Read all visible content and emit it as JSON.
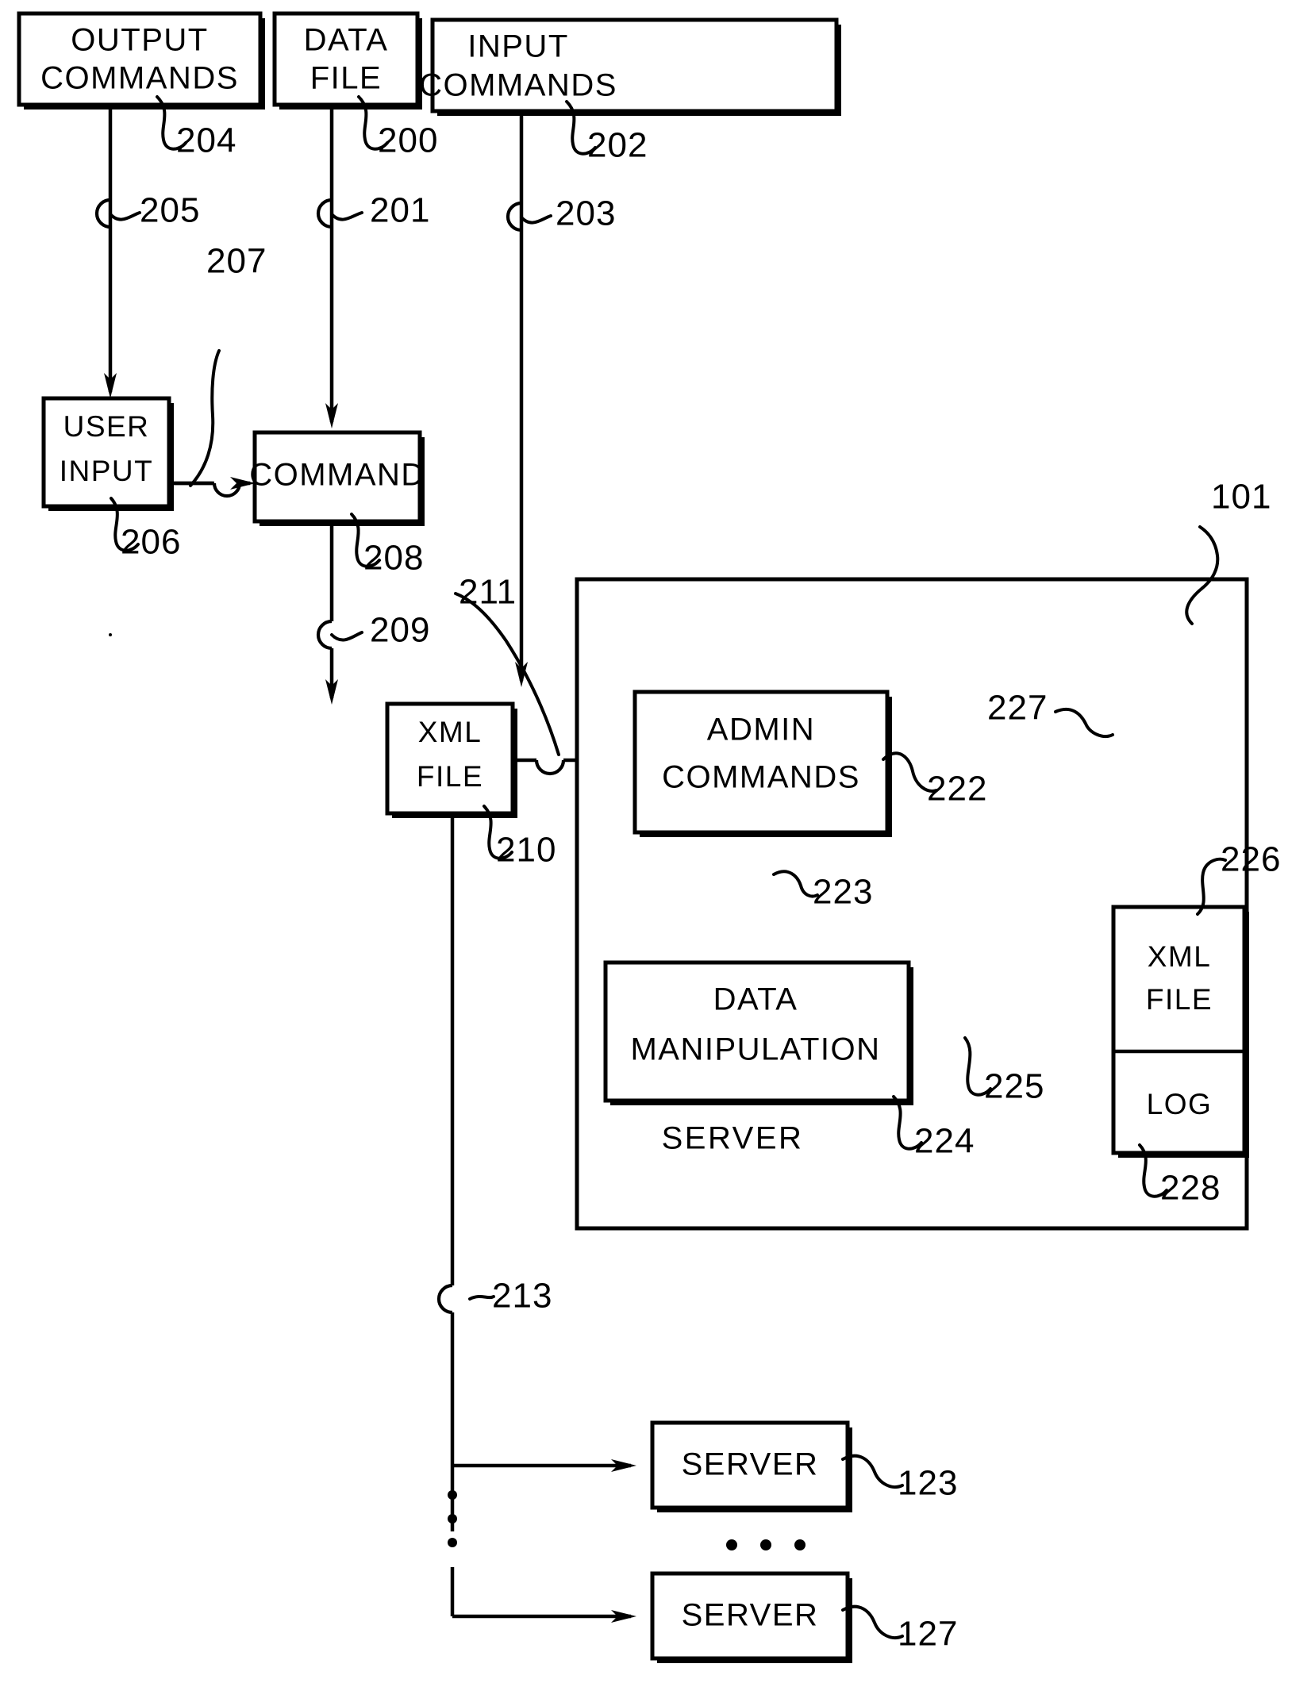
{
  "figure": {
    "type": "patent-block-diagram",
    "background": "#ffffff",
    "ink_color": "#000000"
  },
  "boxes": {
    "output_commands": {
      "line1": "OUTPUT",
      "line2": "COMMANDS",
      "ref": "204"
    },
    "data_file": {
      "line1": "DATA",
      "line2": "FILE",
      "ref": "200"
    },
    "input_commands": {
      "line1": "INPUT",
      "line2": "COMMANDS",
      "ref": "202"
    },
    "user_input": {
      "line1": "USER",
      "line2": "INPUT",
      "ref": "206"
    },
    "command": {
      "line1": "COMMAND",
      "ref": "208"
    },
    "xml_file_client": {
      "line1": "XML",
      "line2": "FILE",
      "ref": "210"
    },
    "admin_commands": {
      "line1": "ADMIN",
      "line2": "COMMANDS",
      "ref": "222"
    },
    "data_manipulation": {
      "line1": "DATA",
      "line2": "MANIPULATION",
      "ref": "224"
    },
    "xml_file_server": {
      "line1": "XML",
      "line2": "FILE",
      "ref": "226"
    },
    "log": {
      "line1": "LOG",
      "ref": "228"
    },
    "server_container": {
      "label": "SERVER",
      "ref": "101"
    },
    "server_123": {
      "label": "SERVER",
      "ref": "123"
    },
    "server_127": {
      "label": "SERVER",
      "ref": "127"
    }
  },
  "connector_refs": {
    "output_to_user_input": "205",
    "data_file_to_command": "201",
    "input_commands_to_admin": "203",
    "user_input_to_command": "207",
    "command_to_xml_file": "209",
    "xml_file_to_admin": "211",
    "admin_to_data_manipulation": "223",
    "data_manipulation_to_xml_file": "225",
    "xml_file_back_to_admin": "227",
    "xml_file_to_servers": "213"
  },
  "ellipsis": {
    "vertical_dots": "3 dots",
    "horizontal_dots": "3 dots"
  }
}
